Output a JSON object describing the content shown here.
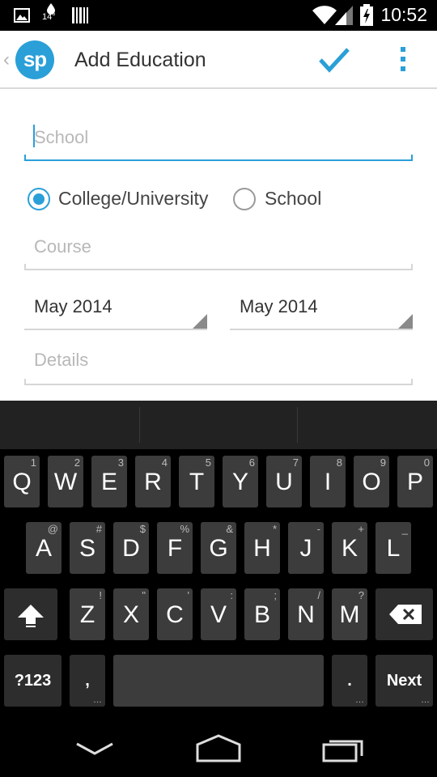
{
  "status_bar": {
    "time": "10:52",
    "temperature": "14°",
    "icons": [
      "gallery-icon",
      "weather-drop-icon",
      "barcode-icon",
      "wifi-icon",
      "signal-icon",
      "battery-charging-icon"
    ]
  },
  "action_bar": {
    "logo_text": "sp",
    "title": "Add Education",
    "accent_color": "#2a9fd8"
  },
  "form": {
    "school_placeholder": "School",
    "school_value": "",
    "type_options": [
      {
        "label": "College/University",
        "selected": true
      },
      {
        "label": "School",
        "selected": false
      }
    ],
    "course_placeholder": "Course",
    "start_date": "May 2014",
    "end_date": "May 2014",
    "details_placeholder": "Details"
  },
  "keyboard": {
    "row1": [
      {
        "key": "Q",
        "hint": "1"
      },
      {
        "key": "W",
        "hint": "2"
      },
      {
        "key": "E",
        "hint": "3"
      },
      {
        "key": "R",
        "hint": "4"
      },
      {
        "key": "T",
        "hint": "5"
      },
      {
        "key": "Y",
        "hint": "6"
      },
      {
        "key": "U",
        "hint": "7"
      },
      {
        "key": "I",
        "hint": "8"
      },
      {
        "key": "O",
        "hint": "9"
      },
      {
        "key": "P",
        "hint": "0"
      }
    ],
    "row2": [
      {
        "key": "A",
        "hint": "@"
      },
      {
        "key": "S",
        "hint": "#"
      },
      {
        "key": "D",
        "hint": "$"
      },
      {
        "key": "F",
        "hint": "%"
      },
      {
        "key": "G",
        "hint": "&"
      },
      {
        "key": "H",
        "hint": "*"
      },
      {
        "key": "J",
        "hint": "-"
      },
      {
        "key": "K",
        "hint": "+"
      },
      {
        "key": "L",
        "hint": "_"
      }
    ],
    "row3": [
      {
        "key": "Z",
        "hint": "!"
      },
      {
        "key": "X",
        "hint": "\""
      },
      {
        "key": "C",
        "hint": "'"
      },
      {
        "key": "V",
        "hint": ":"
      },
      {
        "key": "B",
        "hint": ";"
      },
      {
        "key": "N",
        "hint": "/"
      },
      {
        "key": "M",
        "hint": "?"
      }
    ],
    "symbols_label": "?123",
    "comma_label": ",",
    "period_label": ".",
    "next_label": "Next"
  }
}
